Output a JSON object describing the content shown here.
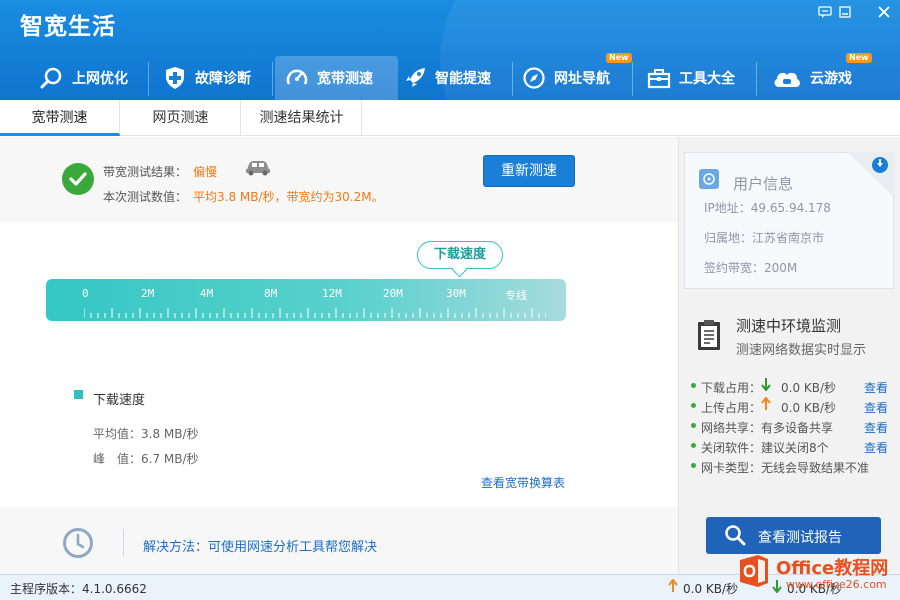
{
  "app": {
    "title": "智宽生活"
  },
  "window_controls": [
    "feedback-icon",
    "minimize-icon",
    "close-icon"
  ],
  "nav": {
    "items": [
      {
        "label": "上网优化",
        "icon": "search-icon"
      },
      {
        "label": "故障诊断",
        "icon": "shield-plus-icon"
      },
      {
        "label": "宽带测速",
        "icon": "speedometer-icon",
        "active": true
      },
      {
        "label": "智能提速",
        "icon": "rocket-icon"
      },
      {
        "label": "网址导航",
        "icon": "compass-icon",
        "badge": "New"
      },
      {
        "label": "工具大全",
        "icon": "toolbox-icon"
      },
      {
        "label": "云游戏",
        "icon": "cloud-game-icon",
        "badge": "New"
      }
    ]
  },
  "subtabs": [
    "宽带测速",
    "网页测速",
    "测速结果统计"
  ],
  "result": {
    "label1": "带宽测试结果：",
    "value1": "偏慢",
    "label2": "本次测试数值：",
    "value2": "平均3.8 MB/秒，带宽约为30.2M。",
    "retest_label": "重新测速"
  },
  "gauge": {
    "bubble": "下载速度",
    "ticks": [
      "0",
      "2M",
      "4M",
      "8M",
      "12M",
      "20M",
      "30M",
      "专线"
    ]
  },
  "stats": {
    "legend": "下载速度",
    "avg": "平均值：3.8 MB/秒",
    "peak": "峰　值：6.7 MB/秒",
    "table_link": "查看宽带换算表"
  },
  "solution": {
    "text": "解决方法：可使用网速分析工具帮您解决"
  },
  "user_info": {
    "title": "用户信息",
    "ip": "IP地址：49.65.94.178",
    "location": "归属地：江苏省南京市",
    "bandwidth": "签约带宽：200M"
  },
  "monitor": {
    "title": "测速中环境监测",
    "subtitle": "测速网络数据实时显示",
    "rows": [
      {
        "label": "下载占用：",
        "icon": "down-arrow",
        "value": "0.0 KB/秒",
        "link": "查看"
      },
      {
        "label": "上传占用：",
        "icon": "up-arrow",
        "value": "0.0 KB/秒",
        "link": "查看"
      },
      {
        "label": "网络共享：",
        "value": "有多设备共享",
        "link": "查看"
      },
      {
        "label": "关闭软件：",
        "value": "建议关闭8个",
        "link": "查看"
      },
      {
        "label": "网卡类型：",
        "value": "无线会导致结果不准",
        "link": ""
      }
    ],
    "report_label": "查看测试报告"
  },
  "statusbar": {
    "version": "主程序版本：4.1.0.6662",
    "upload": "0.0 KB/秒",
    "download": "0.0 KB/秒",
    "watermark_title": "Office教程网",
    "watermark_url": "www.office26.com"
  },
  "colors": {
    "header": "#1a8de2",
    "accent_orange": "#ee7a16",
    "gauge_teal": "#34c7c3",
    "link_blue": "#1a6fc4",
    "success_green": "#3aa83a"
  }
}
